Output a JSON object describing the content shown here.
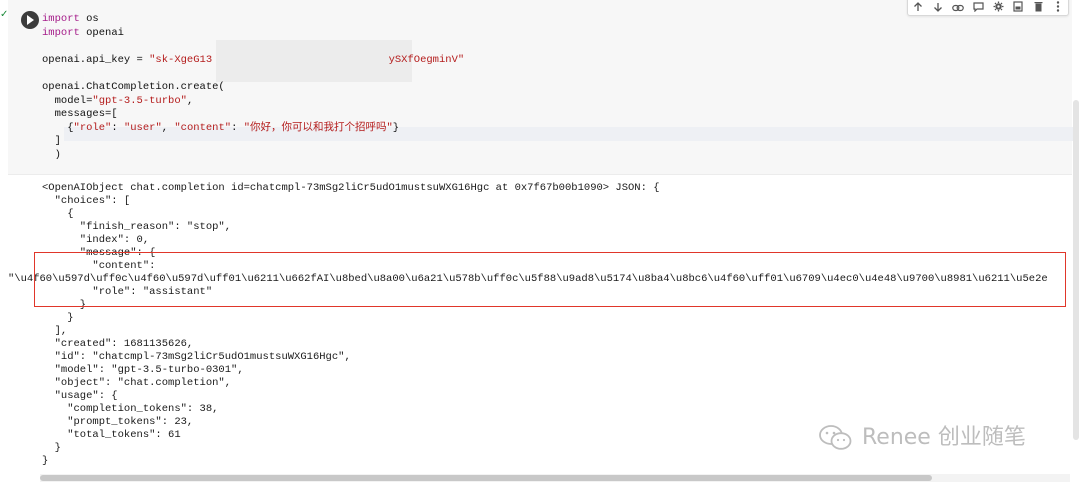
{
  "code": {
    "lines": [
      {
        "parts": [
          {
            "t": "import",
            "c": "kw"
          },
          {
            "t": " os",
            "c": ""
          }
        ]
      },
      {
        "parts": [
          {
            "t": "import",
            "c": "kw"
          },
          {
            "t": " openai",
            "c": ""
          }
        ]
      },
      {
        "parts": [
          {
            "t": "",
            "c": ""
          }
        ]
      },
      {
        "parts": [
          {
            "t": "openai.api_key = ",
            "c": ""
          },
          {
            "t": "\"sk-XgeG13",
            "c": "str"
          },
          {
            "t": "                            ",
            "c": ""
          },
          {
            "t": "ySXfOegminV\"",
            "c": "str"
          }
        ]
      },
      {
        "parts": [
          {
            "t": "",
            "c": ""
          }
        ]
      },
      {
        "parts": [
          {
            "t": "openai.ChatCompletion.create(",
            "c": ""
          }
        ]
      },
      {
        "parts": [
          {
            "t": "  model=",
            "c": ""
          },
          {
            "t": "\"gpt-3.5-turbo\"",
            "c": "str"
          },
          {
            "t": ",",
            "c": ""
          }
        ]
      },
      {
        "parts": [
          {
            "t": "  messages=[",
            "c": ""
          }
        ]
      },
      {
        "parts": [
          {
            "t": "    {",
            "c": ""
          },
          {
            "t": "\"role\"",
            "c": "str"
          },
          {
            "t": ": ",
            "c": ""
          },
          {
            "t": "\"user\"",
            "c": "str"
          },
          {
            "t": ", ",
            "c": ""
          },
          {
            "t": "\"content\"",
            "c": "str"
          },
          {
            "t": ": ",
            "c": ""
          },
          {
            "t": "\"你好，你可以和我打个招呼吗\"",
            "c": "str"
          },
          {
            "t": "}",
            "c": ""
          }
        ]
      },
      {
        "parts": [
          {
            "t": "  ]",
            "c": ""
          }
        ]
      },
      {
        "parts": [
          {
            "t": "  )",
            "c": ""
          }
        ]
      }
    ]
  },
  "output": {
    "lines": [
      "<OpenAIObject chat.completion id=chatcmpl-73mSg2liCr5udO1mustsuWXG16Hgc at 0x7f67b00b1090> JSON: {",
      "  \"choices\": [",
      "    {",
      "      \"finish_reason\": \"stop\",",
      "      \"index\": 0,",
      "      \"message\": {",
      "        \"content\":",
      "\"\\u4f60\\u597d\\uff0c\\u4f60\\u597d\\uff01\\u6211\\u662fAI\\u8bed\\u8a00\\u6a21\\u578b\\uff0c\\u5f88\\u9ad8\\u5174\\u8ba4\\u8bc6\\u4f60\\uff01\\u6709\\u4ec0\\u4e48\\u9700\\u8981\\u6211\\u5e2e",
      "        \"role\": \"assistant\"",
      "      }",
      "    }",
      "  ],",
      "  \"created\": 1681135626,",
      "  \"id\": \"chatcmpl-73mSg2liCr5udO1mustsuWXG16Hgc\",",
      "  \"model\": \"gpt-3.5-turbo-0301\",",
      "  \"object\": \"chat.completion\",",
      "  \"usage\": {",
      "    \"completion_tokens\": 38,",
      "    \"prompt_tokens\": 23,",
      "    \"total_tokens\": 61",
      "  }",
      "}"
    ]
  },
  "toolbar": {
    "icons": [
      "arrow-up-icon",
      "arrow-down-icon",
      "link-icon",
      "comment-icon",
      "gear-icon",
      "mirror-cell-icon",
      "delete-icon",
      "more-vert-icon"
    ]
  },
  "watermark": {
    "text": "Renee 创业随笔"
  },
  "colors": {
    "keyword": "#a51d8a",
    "string": "#b41c1c",
    "highlight_box": "#e0362a"
  }
}
